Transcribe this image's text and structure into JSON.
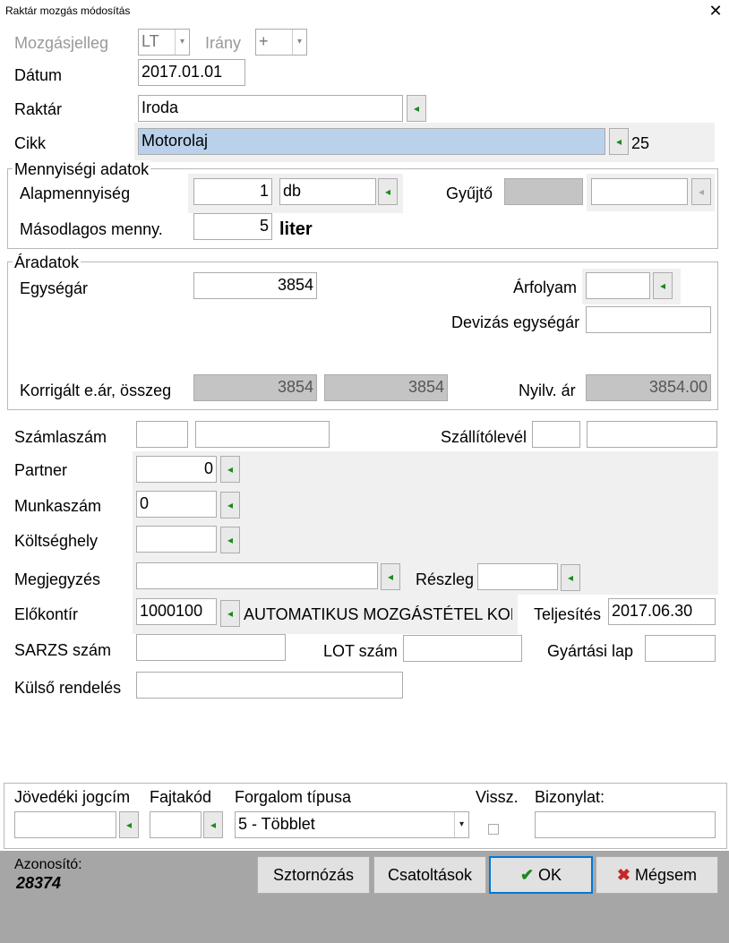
{
  "window": {
    "title": "Raktár mozgás módosítás"
  },
  "header": {
    "mozgasjelleg_label": "Mozgásjelleg",
    "mozgasjelleg_value": "LT",
    "irany_label": "Irány",
    "irany_value": "+",
    "datum_label": "Dátum",
    "datum_value": "2017.01.01",
    "raktar_label": "Raktár",
    "raktar_value": "Iroda",
    "cikk_label": "Cikk",
    "cikk_value": "Motorolaj",
    "cikk_extra": "25"
  },
  "mennyiseg": {
    "legend": "Mennyiségi adatok",
    "alap_label": "Alapmennyiség",
    "alap_value": "1",
    "unit_value": "db",
    "gyujto_label": "Gyűjtő",
    "masod_label": "Másodlagos menny.",
    "masod_value": "5",
    "masod_unit": "liter"
  },
  "aradatok": {
    "legend": "Áradatok",
    "egysegar_label": "Egységár",
    "egysegar_value": "3854",
    "arfolyam_label": "Árfolyam",
    "devizas_label": "Devizás egységár",
    "korrigalt_label": "Korrigált e.ár, összeg",
    "korrigalt_value1": "3854",
    "korrigalt_value2": "3854",
    "nyilv_label": "Nyilv. ár",
    "nyilv_value": "3854.00"
  },
  "details": {
    "szamlaszam_label": "Számlaszám",
    "szallitolevel_label": "Szállítólevél",
    "partner_label": "Partner",
    "partner_value": "0",
    "munkaszam_label": "Munkaszám",
    "munkaszam_value": "0",
    "koltseghely_label": "Költséghely",
    "megjegyzes_label": "Megjegyzés",
    "reszleg_label": "Részleg",
    "elokontir_label": "Előkontír",
    "elokontir_value": "1000100",
    "elokontir_desc": "AUTOMATIKUS MOZGÁSTÉTEL KON",
    "teljesites_label": "Teljesítés",
    "teljesites_value": "2017.06.30",
    "sarzs_label": "SARZS szám",
    "lot_label": "LOT szám",
    "gyartasi_label": "Gyártási lap",
    "kulso_label": "Külső rendelés"
  },
  "bottom": {
    "jovedeki_label": "Jövedéki jogcím",
    "fajtakod_label": "Fajtakód",
    "forgalom_label": "Forgalom típusa",
    "forgalom_value": "5 - Többlet",
    "vissz_label": "Vissz.",
    "bizonylat_label": "Bizonylat:"
  },
  "status": {
    "azonosito_label": "Azonosító:",
    "azonosito_value": "28374",
    "storno_label": "Sztornózás",
    "csatolt_label": "Csatoltások",
    "ok_label": "OK",
    "megsem_label": "Mégsem"
  },
  "colors": {
    "accent": "#0078d7",
    "pick_arrow": "#1a8a1a",
    "ok_check": "#1a8a1a",
    "cancel_x": "#c62828"
  }
}
